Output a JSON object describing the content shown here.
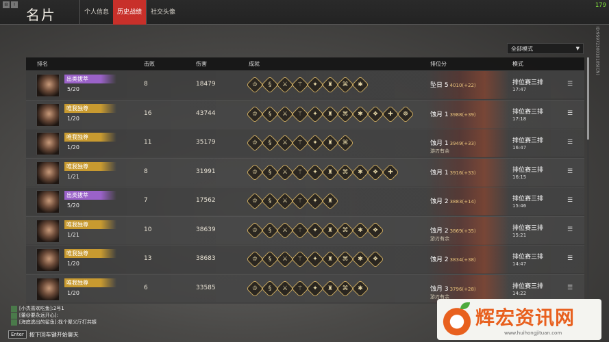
{
  "header": {
    "title": "名片",
    "tabs": [
      {
        "label": "个人信息",
        "active": false
      },
      {
        "label": "历史战绩",
        "active": true
      },
      {
        "label": "社交头像",
        "active": false
      }
    ],
    "fps": "179",
    "side_code": "ID:9597230010105(CN)"
  },
  "filter": {
    "selected": "全部模式"
  },
  "table": {
    "headers": [
      "排名",
      "击败",
      "伤害",
      "成就",
      "排位分",
      "模式"
    ],
    "rows": [
      {
        "badge": "出类拔萃",
        "badge_color": "#9a62c8",
        "rank_frac": "5/20",
        "kills": "8",
        "damage": "18479",
        "ach_count": 8,
        "tier": "坠日 5",
        "points": "4010(+22)",
        "sub": "",
        "mode": "排位赛三排",
        "time": "17:47"
      },
      {
        "badge": "唯我独尊",
        "badge_color": "#c89a30",
        "rank_frac": "1/20",
        "kills": "16",
        "damage": "43744",
        "ach_count": 11,
        "tier": "蚀月 1",
        "points": "3988(+39)",
        "sub": "",
        "mode": "排位赛三排",
        "time": "17:18"
      },
      {
        "badge": "唯我独尊",
        "badge_color": "#c89a30",
        "rank_frac": "1/20",
        "kills": "11",
        "damage": "35179",
        "ach_count": 7,
        "tier": "蚀月 1",
        "points": "3949(+33)",
        "sub": "游刃有余",
        "mode": "排位赛三排",
        "time": "16:47"
      },
      {
        "badge": "唯我独尊",
        "badge_color": "#c89a30",
        "rank_frac": "1/21",
        "kills": "8",
        "damage": "31991",
        "ach_count": 10,
        "tier": "蚀月 1",
        "points": "3916(+33)",
        "sub": "",
        "mode": "排位赛三排",
        "time": "16:15"
      },
      {
        "badge": "出类拔萃",
        "badge_color": "#9a62c8",
        "rank_frac": "5/20",
        "kills": "7",
        "damage": "17562",
        "ach_count": 6,
        "tier": "蚀月 2",
        "points": "3883(+14)",
        "sub": "",
        "mode": "排位赛三排",
        "time": "15:46"
      },
      {
        "badge": "唯我独尊",
        "badge_color": "#c89a30",
        "rank_frac": "1/21",
        "kills": "10",
        "damage": "38639",
        "ach_count": 9,
        "tier": "蚀月 2",
        "points": "3869(+35)",
        "sub": "游刃有余",
        "mode": "排位赛三排",
        "time": "15:21"
      },
      {
        "badge": "唯我独尊",
        "badge_color": "#c89a30",
        "rank_frac": "1/20",
        "kills": "13",
        "damage": "38683",
        "ach_count": 9,
        "tier": "蚀月 2",
        "points": "3834(+38)",
        "sub": "",
        "mode": "排位赛三排",
        "time": "14:47"
      },
      {
        "badge": "唯我独尊",
        "badge_color": "#c89a30",
        "rank_frac": "1/20",
        "kills": "6",
        "damage": "33585",
        "ach_count": 8,
        "tier": "蚀月 3",
        "points": "3796(+28)",
        "sub": "游刃有余",
        "mode": "排位赛三排",
        "time": "14:22"
      }
    ]
  },
  "chat": {
    "lines": [
      "[小杰喜欢吃鱼]:2号1",
      "[蕾@要永远开心]:",
      "[海底逃出的鲨鱼]:找个聚义厅打共振"
    ],
    "enter_key": "Enter",
    "enter_hint": "按下回车键开始聊天"
  },
  "watermark": {
    "text": "辉宏资讯网",
    "url": "www.huihongjituan.com"
  }
}
